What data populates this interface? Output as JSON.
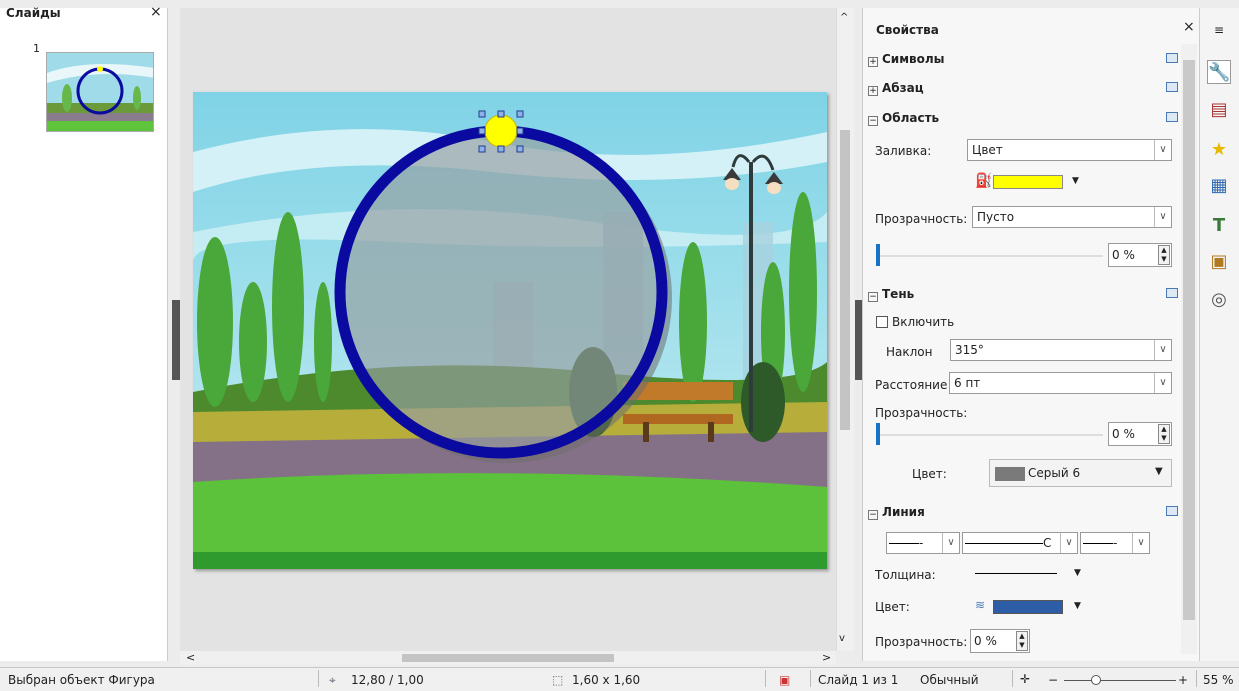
{
  "slides_panel": {
    "title": "Слайды",
    "close": "×",
    "slide_number": "1"
  },
  "properties": {
    "title": "Свойства",
    "close": "×",
    "sections": {
      "symbols": "Символы",
      "paragraph": "Абзац",
      "area": "Область",
      "shadow": "Тень",
      "line": "Линия"
    },
    "area": {
      "fill_label": "Заливка:",
      "fill_value": "Цвет",
      "fill_color": "#ffff00",
      "transparency_label": "Прозрачность:",
      "transparency_value": "Пусто",
      "transparency_percent": "0 %"
    },
    "shadow": {
      "enable_label": "Включить",
      "enabled": false,
      "angle_label": "Наклон",
      "angle_value": "315°",
      "distance_label": "Расстояние",
      "distance_value": "6 пт",
      "transparency_label": "Прозрачность:",
      "transparency_percent": "0 %",
      "color_label": "Цвет:",
      "color_value": "Серый 6",
      "color_swatch": "#7a7a7a"
    },
    "line": {
      "start_arrow": "- ",
      "style": "С",
      "end_arrow": "- ",
      "width_label": "Толщина:",
      "color_label": "Цвет:",
      "color_swatch": "#2e5da8",
      "transparency_label": "Прозрачность:",
      "transparency_value": "0 %"
    }
  },
  "status": {
    "selection": "Выбран объект Фигура",
    "position": "12,80 / 1,00",
    "size": "1,60 x 1,60",
    "slide": "Слайд 1 из 1",
    "layout": "Обычный",
    "zoom": "55 %"
  },
  "colors": {
    "circle_stroke": "#0a0aa0",
    "handle_fill": "#ffff00",
    "sky": "#8fd6e6"
  }
}
